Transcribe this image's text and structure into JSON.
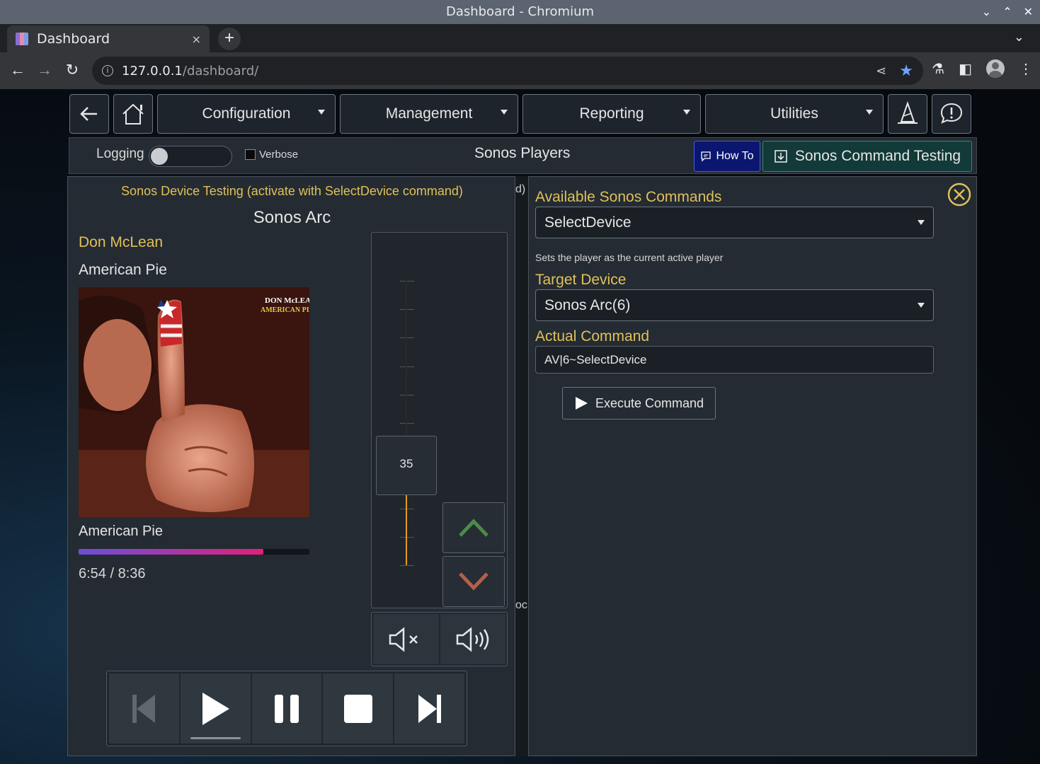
{
  "window": {
    "title": "Dashboard - Chromium"
  },
  "tab": {
    "title": "Dashboard",
    "close": "×",
    "new_tab": "+"
  },
  "address": {
    "host": "127.0.0.1",
    "path": "/dashboard/"
  },
  "nav": {
    "menus": [
      "Configuration",
      "Management",
      "Reporting",
      "Utilities"
    ]
  },
  "subbar": {
    "logging_label": "Logging",
    "logging_on": false,
    "verbose_label": "Verbose",
    "verbose_checked": false,
    "title": "Sonos Players",
    "howto_label": "How To",
    "command_testing_label": "Sonos Command Testing"
  },
  "device_panel": {
    "header": "Sonos Device Testing (activate with SelectDevice command)",
    "device_name": "Sonos Arc",
    "artist": "Don McLean",
    "track": "American Pie",
    "album_art_text": [
      "DON McLEAN",
      "AMERICAN PIE"
    ],
    "album": "American Pie",
    "progress": 0.8,
    "time": "6:54 / 8:36",
    "volume": "35",
    "volume_level": 0.35
  },
  "background_fragments": {
    "top": "d)",
    "bottom": "oc"
  },
  "command_panel": {
    "commands_label": "Available Sonos Commands",
    "command_value": "SelectDevice",
    "command_help": "Sets the player as the current active player",
    "target_label": "Target Device",
    "target_value": "Sonos Arc(6)",
    "actual_label": "Actual Command",
    "actual_value": "AV|6~SelectDevice",
    "execute_label": "Execute Command"
  },
  "colors": {
    "accent": "#e0c05a",
    "howto_bg": "#0b1670",
    "command_btn_bg": "#123a38",
    "progress_start": "#6b4fd8",
    "progress_end": "#e0207a",
    "vol_up": "#4c8a4a",
    "vol_down": "#b0614c"
  }
}
